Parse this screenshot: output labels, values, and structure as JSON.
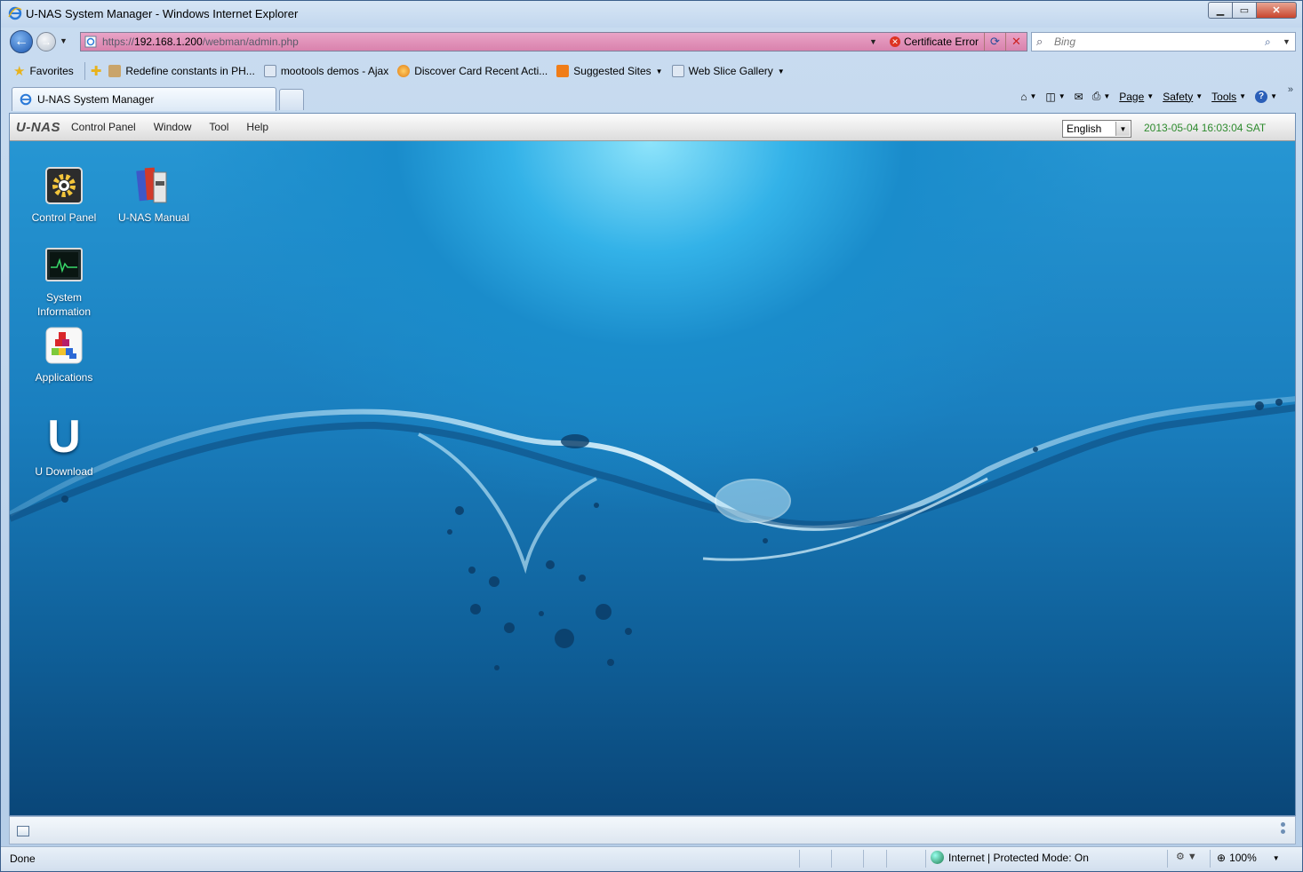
{
  "window": {
    "title": "U-NAS System Manager - Windows Internet Explorer",
    "icon": "ie-icon",
    "buttons": [
      "minimize-button",
      "maximize-button",
      "close-button"
    ]
  },
  "address_bar": {
    "url_prefix": "https://",
    "url_host": "192.168.1.200",
    "url_path": "/webman/admin.php",
    "cert_error": "Certificate Error"
  },
  "search": {
    "placeholder": "Bing"
  },
  "favorites": {
    "label": "Favorites",
    "items": [
      {
        "label": "Redefine constants in PH..."
      },
      {
        "label": "mootools demos - Ajax"
      },
      {
        "label": "Discover Card Recent Acti..."
      },
      {
        "label": "Suggested Sites"
      },
      {
        "label": "Web Slice Gallery"
      }
    ]
  },
  "tab": {
    "label": "U-NAS System Manager"
  },
  "commandbar": {
    "page": "Page",
    "safety": "Safety",
    "tools": "Tools"
  },
  "app": {
    "logo": "U-NAS",
    "menu": [
      "Control Panel",
      "Window",
      "Tool",
      "Help"
    ],
    "language": "English",
    "datetime": "2013-05-04 16:03:04 SAT"
  },
  "desktop_icons": [
    {
      "label": "Control Panel",
      "icon": "gear-icon"
    },
    {
      "label": "U-NAS Manual",
      "icon": "books-icon"
    },
    {
      "label": "System Information",
      "icon": "monitor-pulse-icon"
    },
    {
      "label": "Applications",
      "icon": "apps-blocks-icon"
    },
    {
      "label": "U Download",
      "icon": "u-download-icon"
    }
  ],
  "status": {
    "text": "Done",
    "zone": "Internet | Protected Mode: On",
    "zoom": "100%"
  }
}
